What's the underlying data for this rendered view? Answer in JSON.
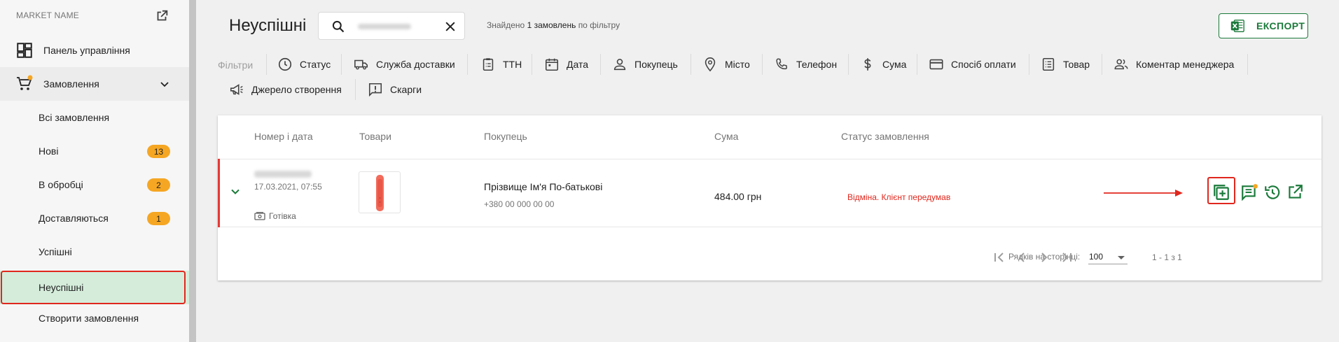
{
  "sidebar": {
    "market_name": "MARKET NAME",
    "dashboard_label": "Панель управління",
    "orders_label": "Замовлення",
    "sub_items": [
      {
        "label": "Всі замовлення",
        "badge": ""
      },
      {
        "label": "Нові",
        "badge": "13"
      },
      {
        "label": "В обробці",
        "badge": "2"
      },
      {
        "label": "Доставляються",
        "badge": "1"
      },
      {
        "label": "Успішні",
        "badge": ""
      },
      {
        "label": "Неуспішні",
        "badge": ""
      },
      {
        "label": "Створити замовлення",
        "badge": ""
      }
    ]
  },
  "header": {
    "title": "Неуспішні",
    "found_prefix": "Знайдено",
    "found_count": "1 замовлень",
    "found_suffix": "по фільтру",
    "export_label": "ЕКСПОРТ"
  },
  "filters": {
    "label": "Фільтри",
    "items": [
      "Статус",
      "Служба доставки",
      "ТТН",
      "Дата",
      "Покупець",
      "Місто",
      "Телефон",
      "Сума",
      "Спосіб оплати",
      "Товар",
      "Коментар менеджера",
      "Джерело створення",
      "Скарги"
    ]
  },
  "table": {
    "columns": [
      "Номер і дата",
      "Товари",
      "Покупець",
      "Сума",
      "Статус замовлення"
    ],
    "row": {
      "date": "17.03.2021, 07:55",
      "payment": "Готівка",
      "buyer_name": "Прізвище Ім'я По-батькові",
      "buyer_phone": "+380 00 000 00 00",
      "sum": "484.00 грн",
      "status": "Відміна. Клієнт передумав"
    },
    "pager": {
      "rows_label": "Рядків на сторінці:",
      "rows_value": "100",
      "range": "1 - 1 з 1"
    }
  },
  "colors": {
    "accent": "#1a7a3a",
    "badge": "#f5a623",
    "error": "#e0271d",
    "active_bg": "#d5ecdb"
  }
}
